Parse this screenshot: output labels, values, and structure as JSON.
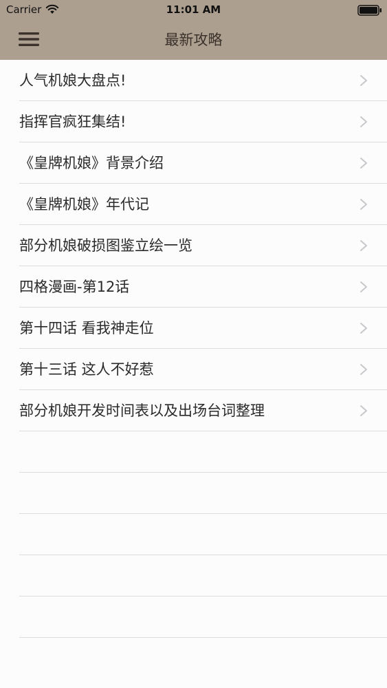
{
  "status_bar": {
    "carrier": "Carrier",
    "time": "11:01 AM",
    "icons": [
      "wifi-icon",
      "battery-icon"
    ]
  },
  "nav_bar": {
    "title": "最新攻略",
    "left_icon": "hamburger-menu-icon"
  },
  "list": {
    "items": [
      {
        "label": "人气机娘大盘点!"
      },
      {
        "label": "指挥官疯狂集结!"
      },
      {
        "label": "《皇牌机娘》背景介绍"
      },
      {
        "label": "《皇牌机娘》年代记"
      },
      {
        "label": "部分机娘破损图鉴立绘一览"
      },
      {
        "label": "四格漫画-第12话"
      },
      {
        "label": "第十四话 看我神走位"
      },
      {
        "label": "第十三话 这人不好惹"
      },
      {
        "label": "部分机娘开发时间表以及出场台词整理"
      }
    ],
    "row_icon": "chevron-right-icon"
  },
  "colors": {
    "header_background": "#ad9f8f",
    "page_background": "#fdfcfd",
    "separator": "#dcdcdc",
    "chevron": "#c7c7cc",
    "text": "#2a2a2a"
  }
}
